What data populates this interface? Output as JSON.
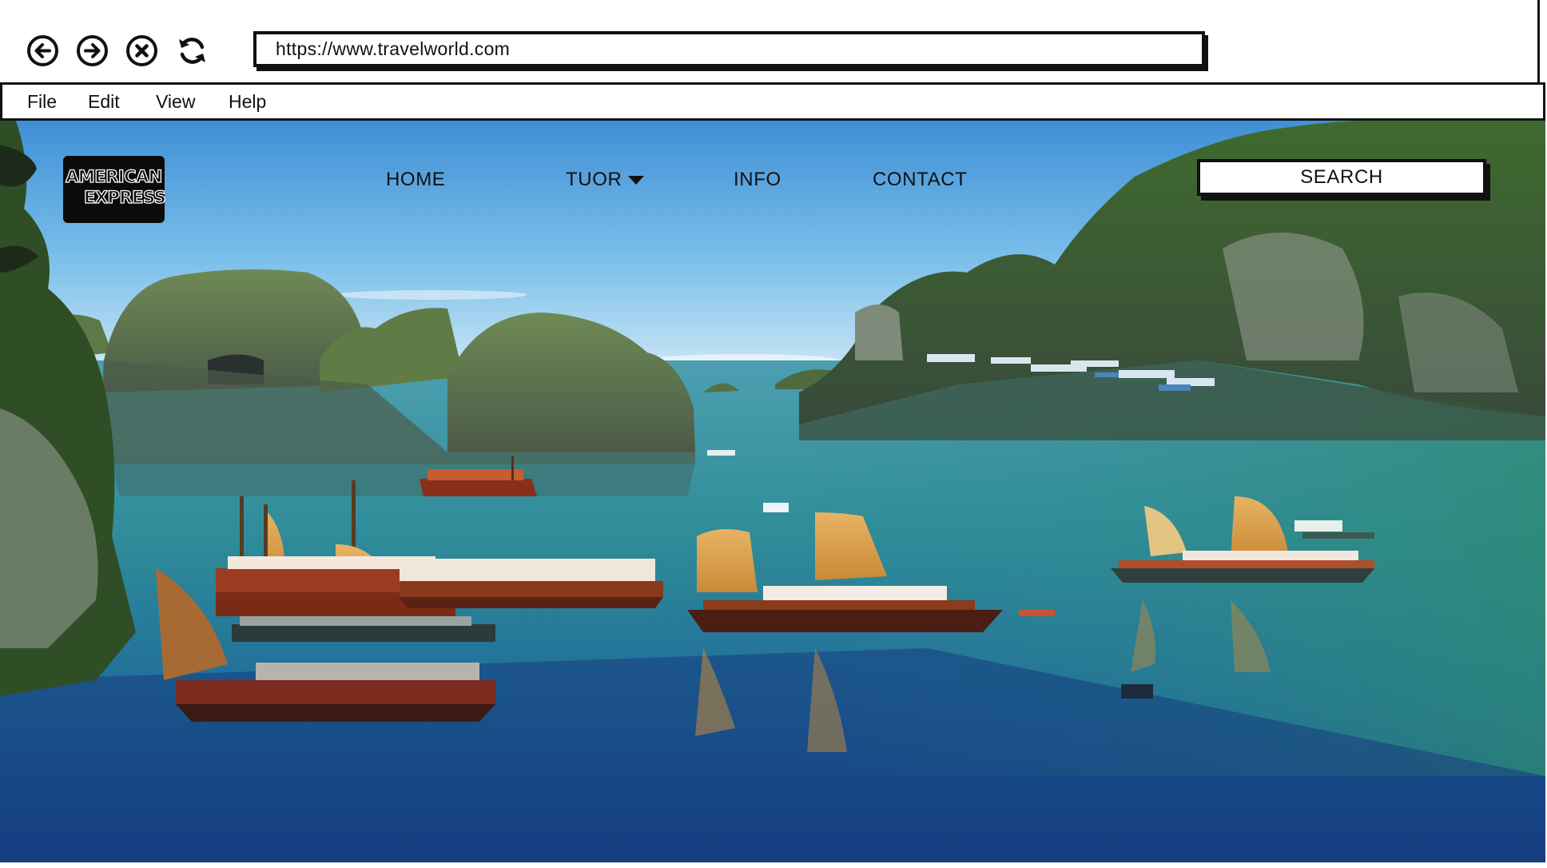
{
  "browser": {
    "url": "https://www.travelworld.com",
    "nav_icons": [
      "back-icon",
      "forward-icon",
      "stop-icon",
      "refresh-icon"
    ]
  },
  "menubar": {
    "items": [
      "File",
      "Edit",
      "View",
      "Help"
    ]
  },
  "site": {
    "logo": {
      "line1": "AMERICAN",
      "line2": "EXPRESS"
    },
    "nav": {
      "home": "HOME",
      "tour": "TUOR",
      "info": "INFO",
      "contact": "CONTACT"
    },
    "search_label": "SEARCH"
  },
  "colors": {
    "sky_top": "#3f8fd6",
    "sky_bottom": "#bfe1f4",
    "water": "#2a7fa6",
    "water_deep": "#123f8a",
    "karst": "#4f6e38",
    "sail": "#d8a04a"
  }
}
